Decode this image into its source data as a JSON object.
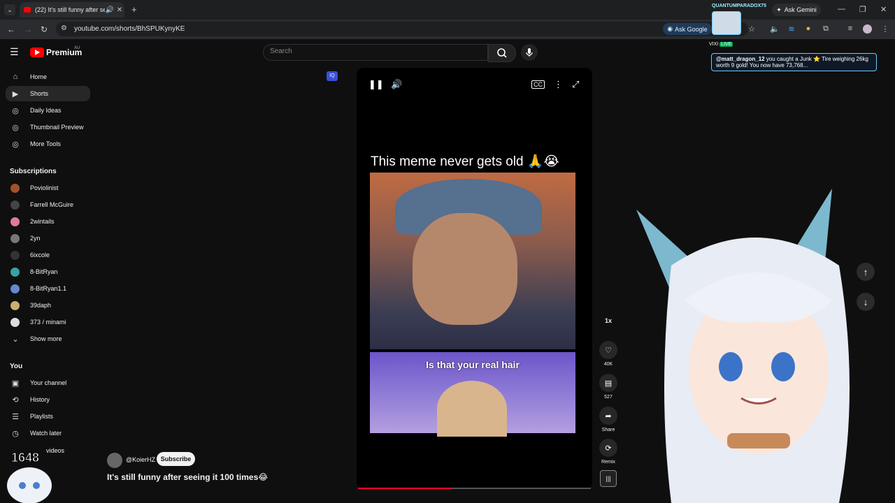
{
  "browser": {
    "tab_title": "(22) It's still funny after seei",
    "new_tab": "+",
    "ask_gemini": "Ask Gemini",
    "url": "youtube.com/shorts/BhSPUKynyKE",
    "ask_google": "Ask Google"
  },
  "youtube": {
    "brand": "Premium",
    "region": "AU",
    "search_placeholder": "Search"
  },
  "sidebar": {
    "primary": [
      {
        "label": "Home",
        "icon": "home-icon"
      },
      {
        "label": "Shorts",
        "icon": "shorts-icon",
        "active": true
      },
      {
        "label": "Daily Ideas",
        "icon": "extension-icon"
      },
      {
        "label": "Thumbnail Preview",
        "icon": "extension-icon"
      },
      {
        "label": "More Tools",
        "icon": "extension-icon"
      }
    ],
    "subscriptions_title": "Subscriptions",
    "subscriptions": [
      {
        "label": "Poviolinist",
        "color": "#a0522d"
      },
      {
        "label": "Farrell McGuire",
        "color": "#444444"
      },
      {
        "label": "2wintails",
        "color": "#e07a9a"
      },
      {
        "label": "2yn",
        "color": "#777777"
      },
      {
        "label": "6ixcole",
        "color": "#333333"
      },
      {
        "label": "8-BitRyan",
        "color": "#3aa0a0"
      },
      {
        "label": "8-BitRyan1.1",
        "color": "#6688cc"
      },
      {
        "label": "39daph",
        "color": "#c9b26e"
      },
      {
        "label": "373 / minami",
        "color": "#dddddd"
      }
    ],
    "show_more": "Show more",
    "you_title": "You",
    "you": [
      {
        "label": "Your channel",
        "icon": "channel-icon"
      },
      {
        "label": "History",
        "icon": "history-icon"
      },
      {
        "label": "Playlists",
        "icon": "playlists-icon"
      },
      {
        "label": "Watch later",
        "icon": "watch-later-icon"
      }
    ],
    "partial": "videos"
  },
  "video": {
    "caption": "This meme never gets old 🙏😭",
    "overlay_text": "Is that your real hair",
    "progress": 0.4
  },
  "actions": {
    "speed": "1x",
    "likes": "40K",
    "comments": "527",
    "share": "Share",
    "remix": "Remix"
  },
  "channel": {
    "handle": "@KoierHZ",
    "subscribe": "Subscribe",
    "title": "It's still funny after seeing it 100 times😂"
  },
  "stream_overlay": {
    "streamer": "QUANTUMPARADOX75",
    "vixi": "VIXI",
    "live": "LIVE",
    "chat_user": "@matt_dragon_12",
    "chat_text": "you caught a Junk ⭐ Tire weighing 26kg worth 9 gold! You now have 73,768...",
    "counter": "1648"
  }
}
